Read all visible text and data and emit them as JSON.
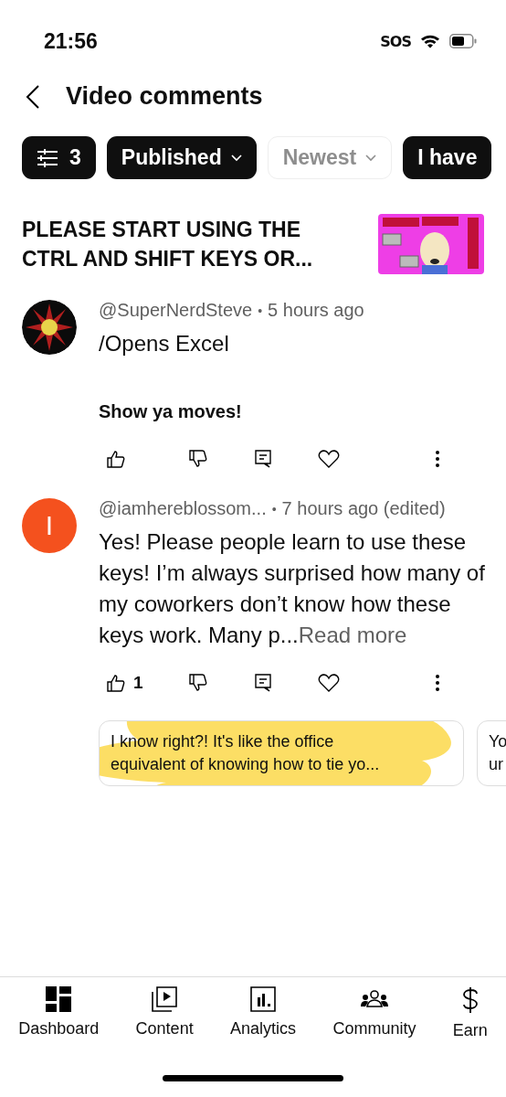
{
  "status_bar": {
    "time": "21:56",
    "carrier": "SOS"
  },
  "header": {
    "title": "Video comments"
  },
  "chips": [
    {
      "kind": "filter",
      "label": "3",
      "selected": true
    },
    {
      "kind": "dropdown",
      "label": "Published",
      "selected": true
    },
    {
      "kind": "dropdown",
      "label": "Newest",
      "selected": false
    },
    {
      "kind": "plain",
      "label": "I have",
      "selected": true
    }
  ],
  "video": {
    "title_lines": [
      "PLEASE START USING THE",
      "CTRL AND SHIFT KEYS OR..."
    ]
  },
  "comments": [
    {
      "author": "@SuperNerdSteve",
      "separator": "•",
      "time": "5 hours ago",
      "paragraphs": [
        {
          "text": "/Opens Excel",
          "bold": false
        },
        {
          "text": "Show ya moves!",
          "bold": true
        }
      ]
    },
    {
      "avatar": {
        "kind": "letter",
        "letter": "I",
        "color": "#f4511e"
      },
      "author": "@iamhereblossom...",
      "separator": "•",
      "time": "7 hours ago (edited)",
      "paragraphs": [
        {
          "text": "Yes! Please people learn to use these keys! I’m always surprised how many of my coworkers don’t know how these keys work. Many p...",
          "bold": false
        }
      ],
      "read_more": "Read more",
      "likes": "1",
      "replies": [
        {
          "lines": [
            "I know right?! It's like the office",
            "equivalent of knowing how to tie yo..."
          ],
          "highlighted": true
        },
        {
          "lines": [
            "Yo",
            "ur"
          ],
          "highlighted": false
        }
      ]
    }
  ],
  "nav": [
    {
      "kind": "dashboard",
      "label": "Dashboard"
    },
    {
      "kind": "content",
      "label": "Content"
    },
    {
      "kind": "analytics",
      "label": "Analytics"
    },
    {
      "kind": "community",
      "label": "Community"
    },
    {
      "kind": "earn",
      "label": "Earn"
    }
  ]
}
